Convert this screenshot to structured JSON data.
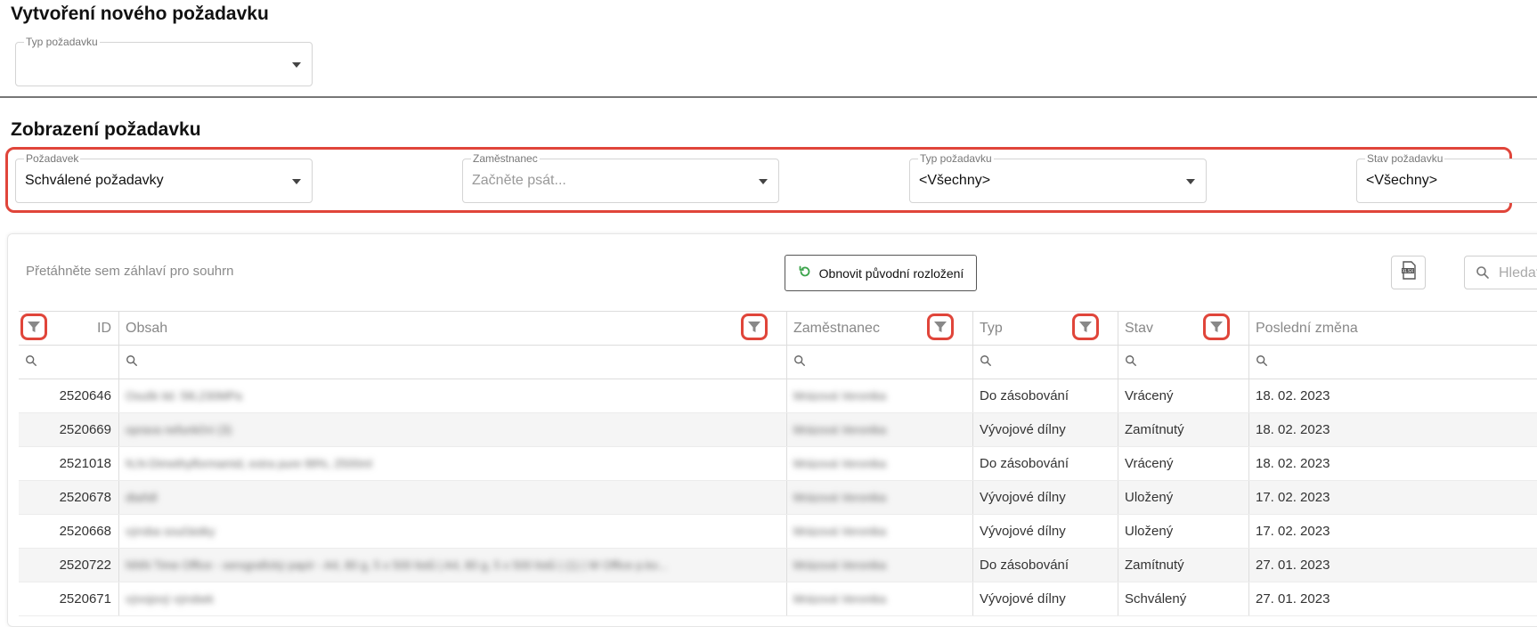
{
  "create_section": {
    "title": "Vytvoření nového požadavku",
    "type_field": {
      "label": "Typ požadavku",
      "value": ""
    }
  },
  "view_section": {
    "title": "Zobrazení požadavku",
    "filters": {
      "request": {
        "label": "Požadavek",
        "value": "Schválené požadavky"
      },
      "employee": {
        "label": "Zaměstnanec",
        "placeholder": "Začněte psát..."
      },
      "type": {
        "label": "Typ požadavku",
        "value": "<Všechny>"
      },
      "status": {
        "label": "Stav požadavku",
        "value": "<Všechny>"
      }
    }
  },
  "toolbar": {
    "group_hint": "Přetáhněte sem záhlaví pro souhrn",
    "reset_label": "Obnovit původní rozložení",
    "export_icon": "xlsx-export-icon",
    "search_placeholder": "Hledat"
  },
  "columns": [
    "ID",
    "Obsah",
    "Zaměstnanec",
    "Typ",
    "Stav",
    "Poslední změna"
  ],
  "rows": [
    {
      "id": "2520646",
      "obsah": "Osušk itd. 5l6,230MPa",
      "zamestnanec": "Mrázová Veronika",
      "typ": "Do zásobování",
      "stav": "Vrácený",
      "zmena": "18. 02. 2023"
    },
    {
      "id": "2520669",
      "obsah": "oprava nefunkční (3)",
      "zamestnanec": "Mrázová Veronika",
      "typ": "Vývojové dílny",
      "stav": "Zamítnutý",
      "zmena": "18. 02. 2023"
    },
    {
      "id": "2521018",
      "obsah": "N,N-Dimethylformamid, extra pure 99%, 2500ml",
      "zamestnanec": "Mrázová Veronika",
      "typ": "Do zásobování",
      "stav": "Vrácený",
      "zmena": "18. 02. 2023"
    },
    {
      "id": "2520678",
      "obsah": "dtaňdl",
      "zamestnanec": "Mrázová Veronika",
      "typ": "Vývojové dílny",
      "stav": "Uložený",
      "zmena": "17. 02. 2023"
    },
    {
      "id": "2520668",
      "obsah": "výroba součástky",
      "zamestnanec": "Mrázová Veronika",
      "typ": "Vývojové dílny",
      "stav": "Uložený",
      "zmena": "17. 02. 2023"
    },
    {
      "id": "2520722",
      "obsah": "NNN Time Office - xerografický papír - A4, 80 g, 5 x 500 listů | A4, 80 g, 5 x 500 listů | (1) | W Office p.ko...",
      "zamestnanec": "Mrázová Veronika",
      "typ": "Do zásobování",
      "stav": "Zamítnutý",
      "zmena": "27. 01. 2023"
    },
    {
      "id": "2520671",
      "obsah": "vývojový výrobek",
      "zamestnanec": "Mrázová Veronika",
      "typ": "Vývojové dílny",
      "stav": "Schválený",
      "zmena": "27. 01. 2023"
    }
  ],
  "colors": {
    "highlight": "#e0453a",
    "reset_icon": "#3aa34a"
  }
}
